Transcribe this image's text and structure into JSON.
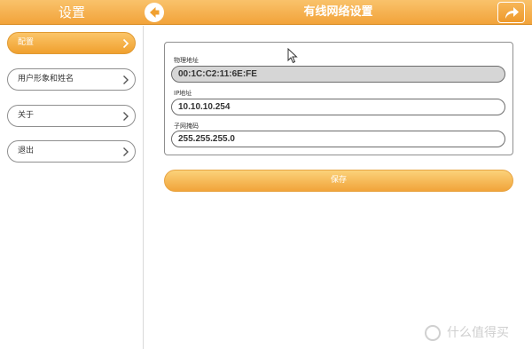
{
  "header": {
    "left_title": "设置",
    "main_title": "有线网络设置"
  },
  "icons": {
    "back": "back-arrow-icon",
    "share": "share-arrow-icon",
    "chevron": "chevron-right-icon"
  },
  "sidebar": {
    "items": [
      {
        "label": "配置",
        "active": true
      },
      {
        "label": "用户形象和姓名",
        "active": false
      },
      {
        "label": "关于",
        "active": false
      },
      {
        "label": "退出",
        "active": false
      }
    ]
  },
  "form": {
    "mac": {
      "label": "物理地址",
      "value": "00:1C:C2:11:6E:FE"
    },
    "ip": {
      "label": "IP地址",
      "value": "10.10.10.254"
    },
    "mask": {
      "label": "子网掩码",
      "value": "255.255.255.0"
    }
  },
  "save_label": "保存",
  "watermark": "什么值得买",
  "colors": {
    "accent": "#f2a33a",
    "accent_light": "#f9c26b"
  }
}
